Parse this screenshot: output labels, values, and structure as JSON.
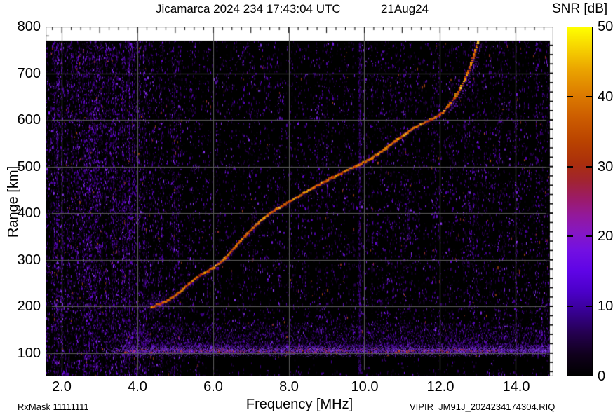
{
  "header": {
    "title": "Jicamarca 2024 234 17:43:04 UTC",
    "date": "21Aug24",
    "colorbar_title": "SNR [dB]"
  },
  "axes": {
    "x": {
      "label": "Frequency [MHz]",
      "tick_labels": [
        "2.0",
        "4.0",
        "6.0",
        "8.0",
        "10.0",
        "12.0",
        "14.0"
      ]
    },
    "y": {
      "label": "Range [km]",
      "tick_labels": [
        "800",
        "700",
        "600",
        "500",
        "400",
        "300",
        "200",
        "100"
      ]
    }
  },
  "colorbar": {
    "tick_labels": [
      "50",
      "40",
      "30",
      "20",
      "10",
      "0"
    ]
  },
  "footer": {
    "rx_mask": "RxMask 11111111",
    "file": "VIPIR  JM91J_2024234174304.RIQ"
  },
  "chart_data": {
    "type": "heatmap",
    "title": "Jicamarca 2024 234 17:43:04 UTC",
    "date": "21Aug24",
    "xlabel": "Frequency [MHz]",
    "ylabel": "Range [km]",
    "zlabel": "SNR [dB]",
    "xlim": [
      1.57,
      15.0
    ],
    "ylim": [
      50,
      800
    ],
    "zlim": [
      0,
      50
    ],
    "x_ticks": [
      2,
      4,
      6,
      8,
      10,
      12,
      14
    ],
    "y_ticks": [
      100,
      200,
      300,
      400,
      500,
      600,
      700,
      800
    ],
    "z_ticks": [
      0,
      10,
      20,
      30,
      40,
      50
    ],
    "grid": true,
    "grid_color": "#5c5c5c",
    "data_top_km": 770,
    "palette": [
      [
        0,
        "#000000"
      ],
      [
        0.06,
        "#10001c"
      ],
      [
        0.12,
        "#24004e"
      ],
      [
        0.18,
        "#36008e"
      ],
      [
        0.24,
        "#4b00c8"
      ],
      [
        0.3,
        "#5f04e6"
      ],
      [
        0.36,
        "#7310e2"
      ],
      [
        0.41,
        "#8517c4"
      ],
      [
        0.46,
        "#93199b"
      ],
      [
        0.51,
        "#9c1b66"
      ],
      [
        0.56,
        "#a12430"
      ],
      [
        0.61,
        "#aa2f0c"
      ],
      [
        0.67,
        "#b94200"
      ],
      [
        0.74,
        "#cc5c00"
      ],
      [
        0.81,
        "#dd7d00"
      ],
      [
        0.88,
        "#eba500"
      ],
      [
        0.94,
        "#f6d200"
      ],
      [
        1,
        "#ffff00"
      ]
    ],
    "f_trace_mhz_km": [
      [
        4.35,
        198
      ],
      [
        4.5,
        203
      ],
      [
        4.65,
        208
      ],
      [
        4.8,
        214
      ],
      [
        4.95,
        221
      ],
      [
        5.1,
        230
      ],
      [
        5.25,
        241
      ],
      [
        5.4,
        252
      ],
      [
        5.55,
        261
      ],
      [
        5.7,
        269
      ],
      [
        5.85,
        276
      ],
      [
        6.0,
        283
      ],
      [
        6.15,
        292
      ],
      [
        6.3,
        303
      ],
      [
        6.45,
        316
      ],
      [
        6.6,
        330
      ],
      [
        6.75,
        344
      ],
      [
        6.9,
        356
      ],
      [
        7.05,
        368
      ],
      [
        7.2,
        380
      ],
      [
        7.35,
        391
      ],
      [
        7.5,
        400
      ],
      [
        7.65,
        408
      ],
      [
        7.8,
        415
      ],
      [
        7.95,
        422
      ],
      [
        8.1,
        429
      ],
      [
        8.25,
        436
      ],
      [
        8.4,
        443
      ],
      [
        8.55,
        450
      ],
      [
        8.7,
        457
      ],
      [
        8.85,
        464
      ],
      [
        9.0,
        470
      ],
      [
        9.15,
        477
      ],
      [
        9.3,
        483
      ],
      [
        9.45,
        489
      ],
      [
        9.6,
        495
      ],
      [
        9.75,
        500
      ],
      [
        9.9,
        506
      ],
      [
        10.05,
        512
      ],
      [
        10.2,
        519
      ],
      [
        10.35,
        527
      ],
      [
        10.5,
        536
      ],
      [
        10.65,
        545
      ],
      [
        10.8,
        554
      ],
      [
        10.95,
        563
      ],
      [
        11.1,
        572
      ],
      [
        11.25,
        580
      ],
      [
        11.4,
        587
      ],
      [
        11.55,
        593
      ],
      [
        11.7,
        599
      ],
      [
        11.85,
        605
      ],
      [
        12.0,
        612
      ],
      [
        12.12,
        621
      ],
      [
        12.24,
        632
      ],
      [
        12.36,
        645
      ],
      [
        12.46,
        658
      ],
      [
        12.56,
        672
      ],
      [
        12.65,
        687
      ],
      [
        12.73,
        702
      ],
      [
        12.8,
        717
      ],
      [
        12.86,
        731
      ],
      [
        12.91,
        744
      ],
      [
        12.95,
        756
      ],
      [
        12.99,
        766
      ],
      [
        13.02,
        772
      ]
    ],
    "f_trace_peak_snr_db": 40,
    "trace_start_blob": {
      "freq_mhz": 4.5,
      "range_km": 207,
      "spread_mhz": 0.35,
      "spread_km": 18
    },
    "faint_trace_mhz_km": [
      [
        6.38,
        695
      ],
      [
        6.55,
        715
      ],
      [
        6.75,
        740
      ],
      [
        6.95,
        768
      ]
    ],
    "e_band": {
      "range_km": [
        96,
        116
      ],
      "haze_top_km": 165,
      "freq_start_mhz": 3.0,
      "core_freq_mhz": [
        3.4,
        13.6
      ],
      "core_snr_db": 25,
      "halo_snr_db": 15
    },
    "interference": [
      {
        "freq_mhz": 9.87,
        "km_span": [
          55,
          768
        ],
        "strength": 0.5
      },
      {
        "freq_mhz": 11.15,
        "km_span": [
          340,
          440
        ],
        "strength": 0.3
      }
    ],
    "noise_regions": [
      {
        "freq_mhz": [
          1.57,
          4.2
        ],
        "density": 0.3
      },
      {
        "freq_mhz": [
          4.2,
          5.2
        ],
        "density": 0.15
      },
      {
        "freq_mhz": [
          5.2,
          10.0
        ],
        "density": 0.07
      },
      {
        "freq_mhz": [
          10.0,
          15.0
        ],
        "density": 0.09
      }
    ],
    "noise_colors": {
      "dark": [
        "#16002a",
        "#22003f",
        "#2c0054"
      ],
      "mid": [
        "#3a0076",
        "#49009c",
        "#5800bf"
      ],
      "bright": [
        "#6a08e2",
        "#7d1cf4",
        "#9036ff"
      ],
      "fleck": [
        "#a03028",
        "#b54a14",
        "#8c46ff"
      ]
    },
    "band_colors": {
      "halo": [
        "#5c10b2",
        "#7020d8",
        "#8436f0",
        "#9850ff"
      ],
      "core": [
        "#a82820",
        "#bf3414",
        "#93200e",
        "#d04a10"
      ]
    },
    "trace_colors": {
      "core": [
        "#b82e06",
        "#d85800",
        "#e67800",
        "#f09600",
        "#f8bc00",
        "#ffe14a"
      ],
      "halo": "#7a18e0"
    }
  }
}
